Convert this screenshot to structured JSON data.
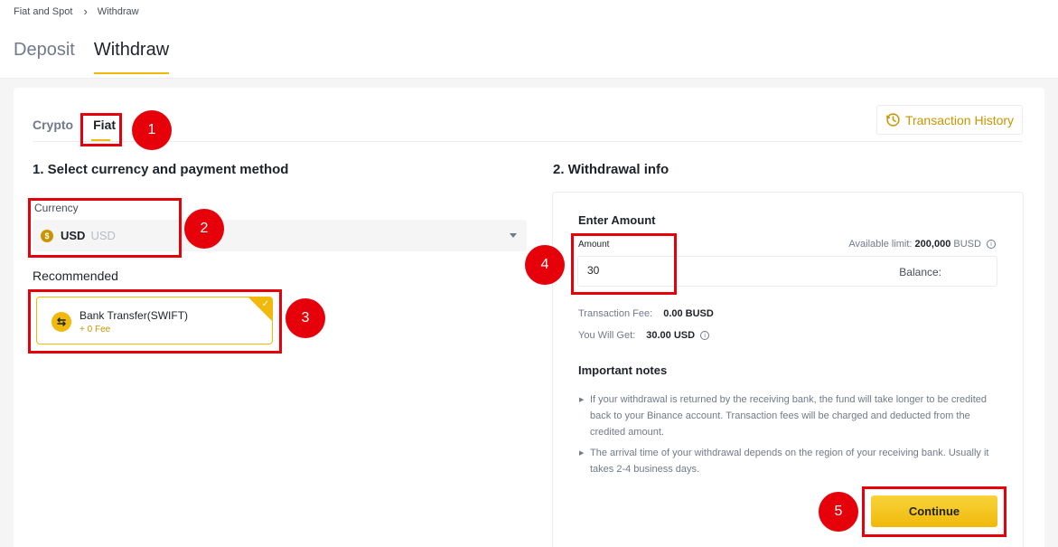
{
  "breadcrumb": {
    "parent": "Fiat and Spot",
    "current": "Withdraw"
  },
  "top_tabs": [
    {
      "label": "Deposit"
    },
    {
      "label": "Withdraw",
      "active": true
    }
  ],
  "sub_tabs": [
    {
      "label": "Crypto"
    },
    {
      "label": "Fiat",
      "active": true
    }
  ],
  "transaction_history": {
    "label": "Transaction History",
    "icon": "history-icon"
  },
  "section1": {
    "title": "1. Select currency and payment method",
    "currency_label": "Currency",
    "currency_code": "USD",
    "currency_subtitle": "USD",
    "recommended_label": "Recommended",
    "method": {
      "name": "Bank Transfer(SWIFT)",
      "fee": "+ 0 Fee"
    }
  },
  "section2": {
    "title": "2. Withdrawal info",
    "enter_amount": "Enter Amount",
    "amount_label": "Amount",
    "available_limit_label": "Available limit:",
    "available_limit_value": "200,000",
    "available_limit_unit": "BUSD",
    "amount_value": "30",
    "balance_label": "Balance:",
    "transaction_fee_label": "Transaction Fee:",
    "transaction_fee_value": "0.00 BUSD",
    "you_will_get_label": "You Will Get:",
    "you_will_get_value": "30.00 USD",
    "notes_title": "Important notes",
    "notes": [
      "If your withdrawal is returned by the receiving bank, the fund will take longer to be credited back to your Binance account. Transaction fees will be charged and deducted from the credited amount.",
      "The arrival time of your withdrawal depends on the region of your receiving bank. Usually it takes 2-4 business days."
    ],
    "continue_label": "Continue"
  },
  "annotations": {
    "steps": [
      "1",
      "2",
      "3",
      "4",
      "5"
    ]
  },
  "colors": {
    "accent": "#f0b90b",
    "annotation_red": "#e5000a",
    "history_text": "#c99400"
  }
}
